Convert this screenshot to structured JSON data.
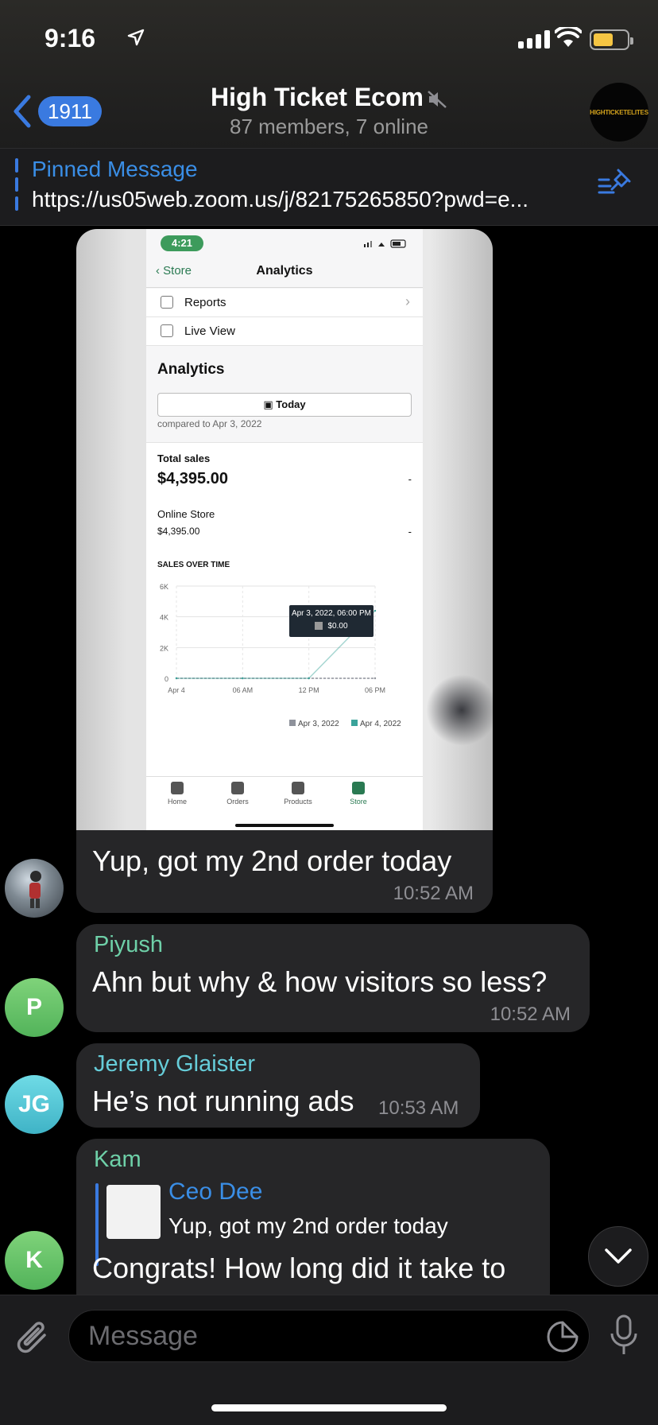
{
  "status_bar": {
    "time": "9:16"
  },
  "header": {
    "back_count": "1911",
    "title": "High Ticket Ecom",
    "subtitle": "87 members, 7 online",
    "avatar_text": "HIGHTICKETELITES"
  },
  "pinned": {
    "title": "Pinned Message",
    "text": "https://us05web.zoom.us/j/82175265850?pwd=e..."
  },
  "screenshot": {
    "time": "4:21",
    "back_label": "Store",
    "nav_title": "Analytics",
    "rows": [
      "Reports",
      "Live View"
    ],
    "heading": "Analytics",
    "date_button": "Today",
    "compared": "compared to Apr 3, 2022",
    "total_sales_label": "Total sales",
    "total_sales_value": "$4,395.00",
    "total_sales_dash": "-",
    "online_store_label": "Online Store",
    "online_store_value": "$4,395.00",
    "online_store_dash": "-",
    "chart_title": "SALES OVER TIME",
    "tooltip_date": "Apr 3, 2022, 06:00 PM",
    "tooltip_value": "$0.00",
    "tabs": [
      "Home",
      "Orders",
      "Products",
      "Store"
    ]
  },
  "chart_data": {
    "type": "line",
    "title": "SALES OVER TIME",
    "x": [
      "Apr 4",
      "06 AM",
      "12 PM",
      "06 PM"
    ],
    "y_ticks": [
      "0",
      "2K",
      "4K",
      "6K"
    ],
    "ylim": [
      0,
      6000
    ],
    "series": [
      {
        "name": "Apr 3, 2022",
        "color": "#8e929b",
        "values": [
          0,
          0,
          0,
          0
        ]
      },
      {
        "name": "Apr 4, 2022",
        "color": "#3aa39a",
        "values": [
          0,
          0,
          0,
          4395
        ]
      }
    ],
    "legend": "bottom-right"
  },
  "messages": [
    {
      "sender": "",
      "text": "Yup, got my 2nd order today",
      "time": "10:52 AM"
    },
    {
      "sender": "Piyush",
      "text": "Ahn but why & how visitors so less?",
      "time": "10:52 AM",
      "initials": "P",
      "color": "#66c56b"
    },
    {
      "sender": "Jeremy Glaister",
      "text": "He’s not running ads",
      "time": "10:53 AM",
      "initials": "JG",
      "color": "#4fc6d6"
    },
    {
      "sender": "Kam",
      "reply_name": "Ceo Dee",
      "reply_text": "Yup, got my 2nd order today",
      "text": "Congrats! How long did it take to",
      "initials": "K",
      "color": "#66c56b"
    }
  ],
  "composer": {
    "placeholder": "Message"
  },
  "colors": {
    "accent": "#3a7ae0",
    "sender_green": "#6ed0a8",
    "sender_cyan": "#66cdd9"
  }
}
